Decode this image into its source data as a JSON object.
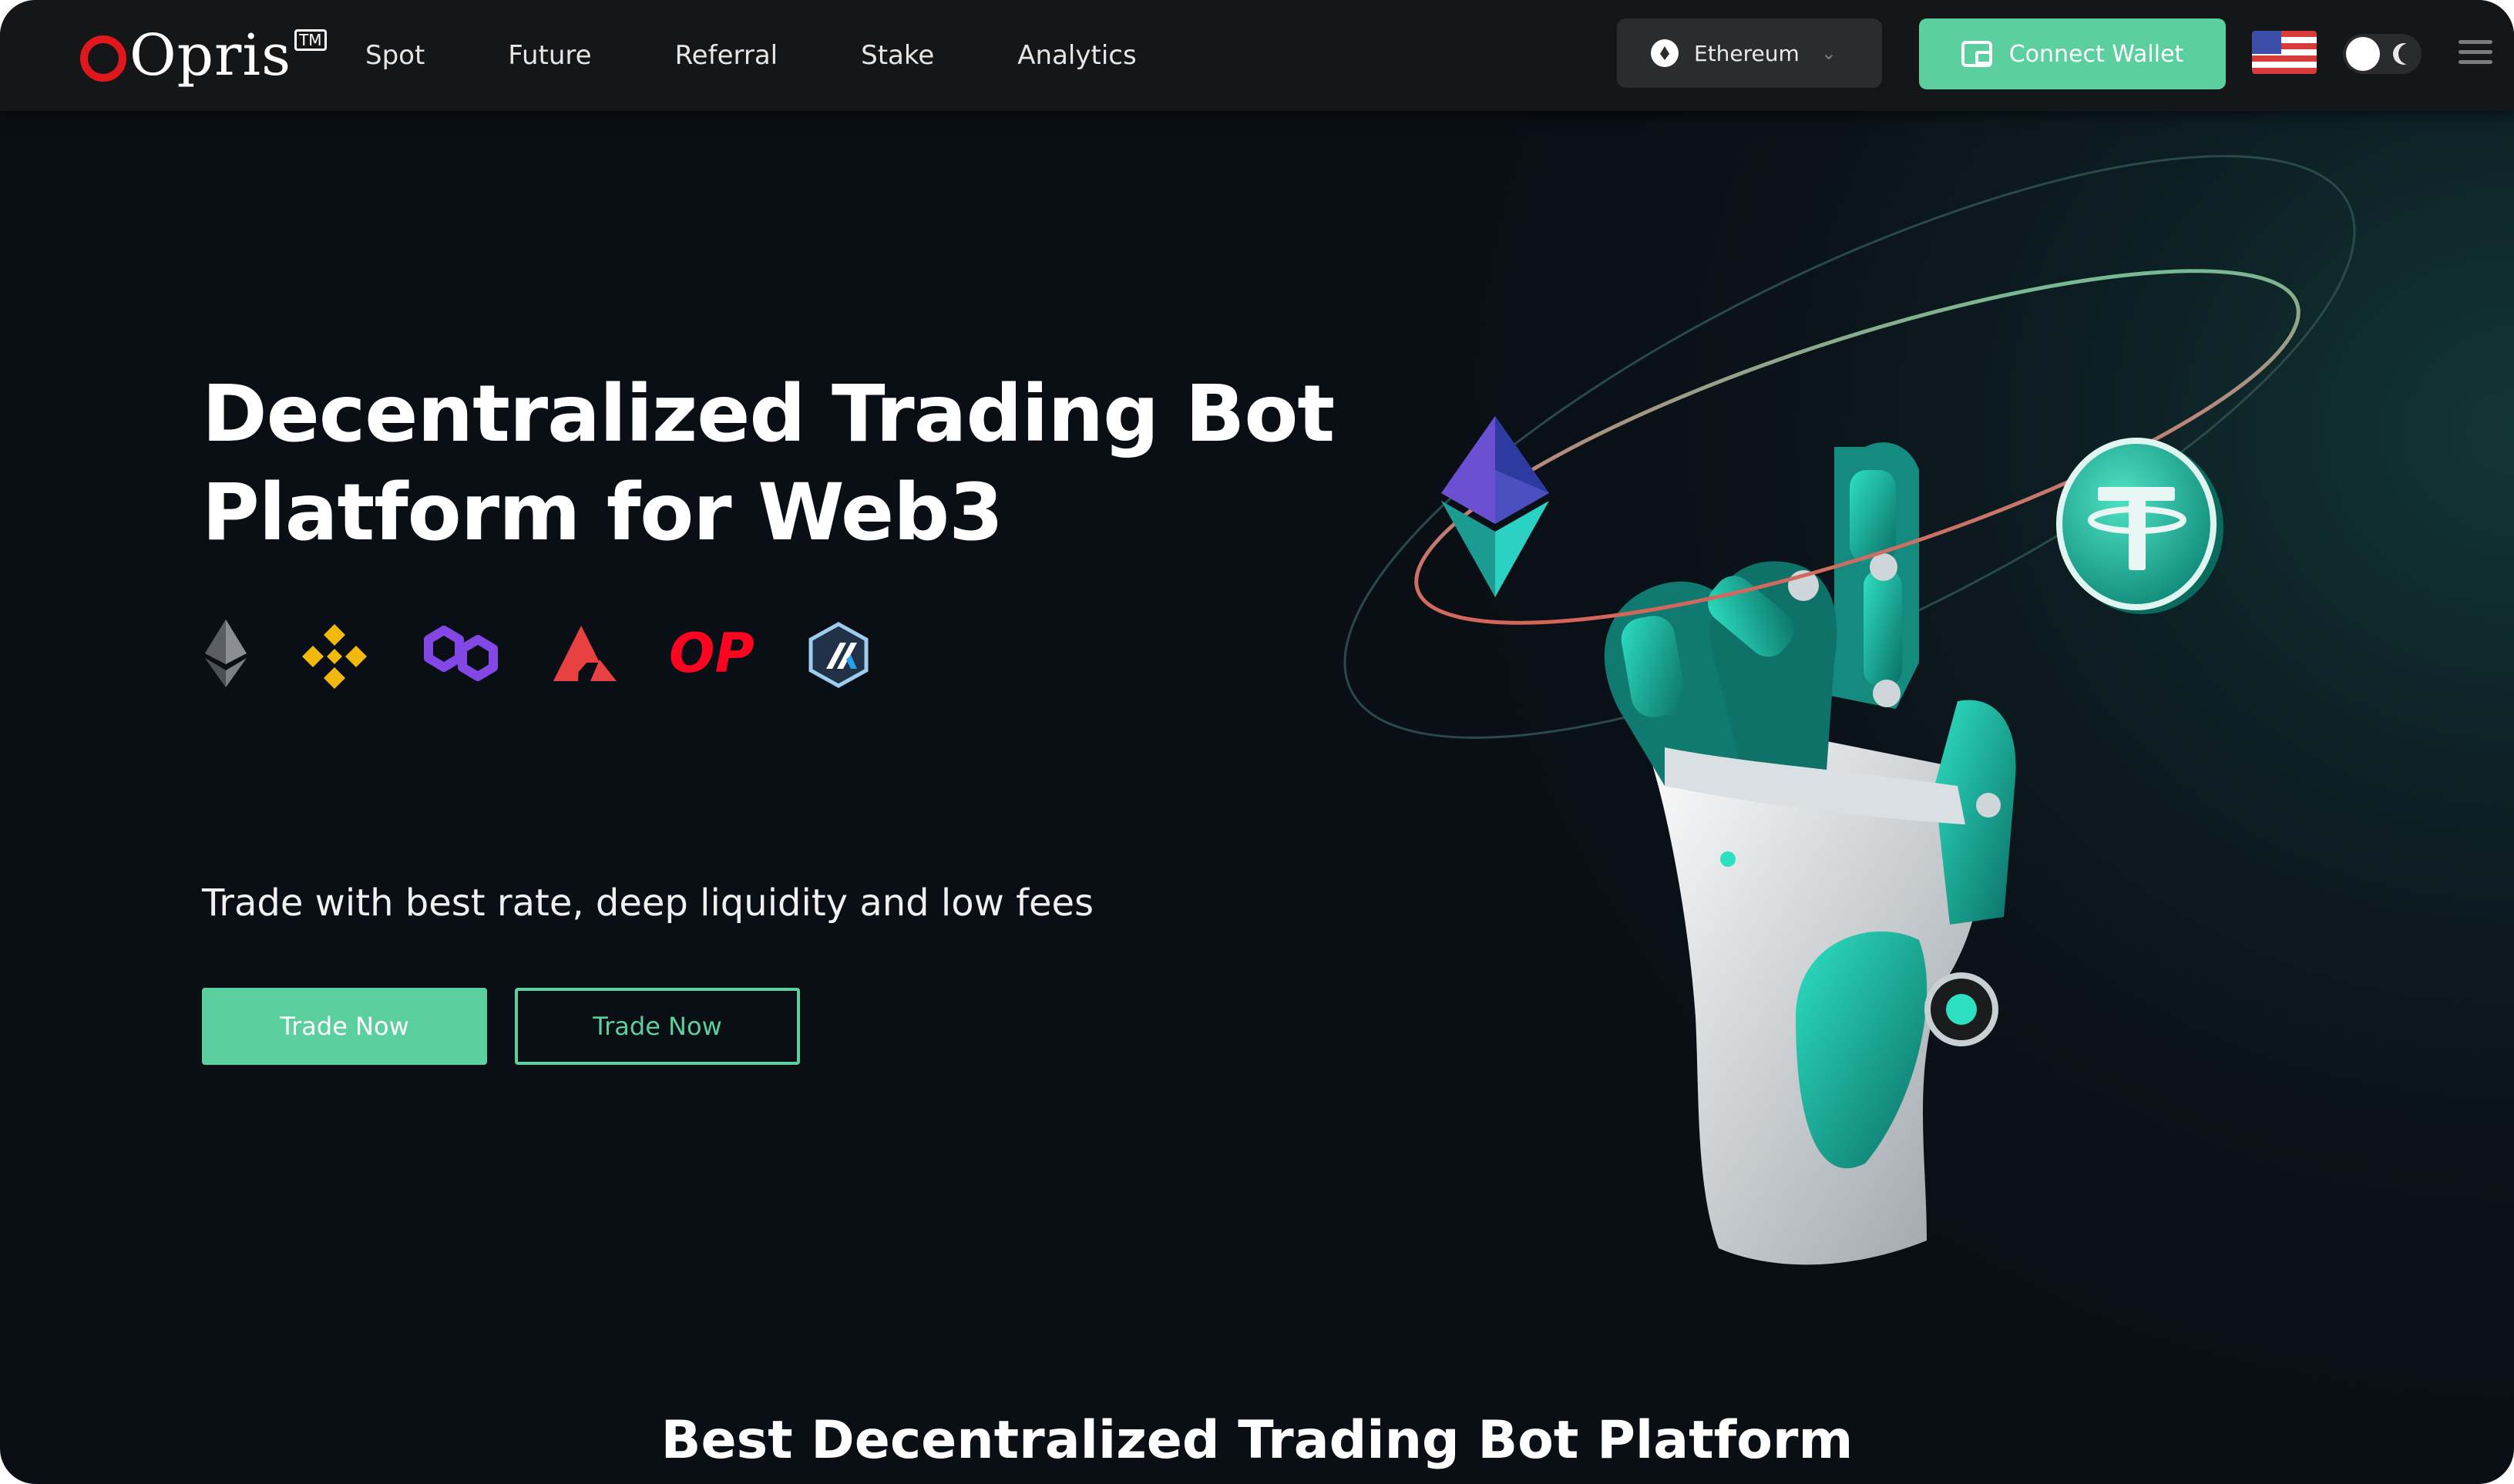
{
  "nav": {
    "brand": "Opris",
    "trademark": "TM",
    "links": [
      "Spot",
      "Future",
      "Referral",
      "Stake",
      "Analytics"
    ],
    "network": "Ethereum",
    "connect_label": "Connect Wallet",
    "flag_icon": "us-flag-icon"
  },
  "hero": {
    "title_line1": "Decentralized Trading Bot",
    "title_line2": "Platform for Web3",
    "chains": [
      "ethereum-icon",
      "bnb-icon",
      "polygon-icon",
      "avalanche-icon",
      "optimism-icon",
      "arbitrum-icon"
    ],
    "optimism_text": "OP",
    "subtitle": "Trade with best rate, deep liquidity and low fees",
    "primary_button": "Trade Now",
    "secondary_button": "Trade Now"
  },
  "section": {
    "title": "Best Decentralized Trading Bot Platform"
  },
  "colors": {
    "accent": "#5ccf9e",
    "nav_bg": "#151618",
    "page_bg": "#0b1219",
    "brand_red": "#e0181b"
  }
}
